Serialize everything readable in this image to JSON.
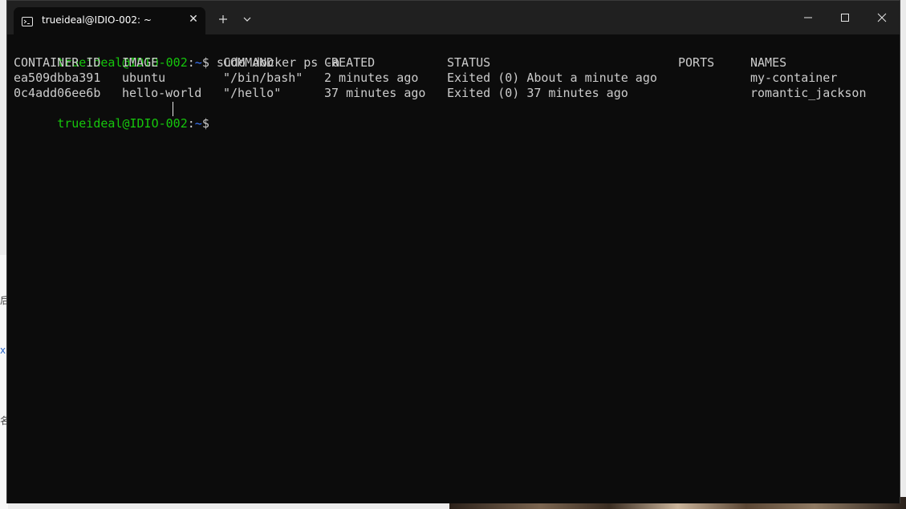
{
  "window": {
    "tab_title": "trueideal@IDIO-002: ~",
    "tab_icon": "terminal-icon",
    "close_tab_glyph": "✕",
    "new_tab_glyph": "+",
    "dropdown_glyph": "⌄"
  },
  "colors": {
    "user_host": "#16c60c",
    "path": "#3b78ff",
    "text": "#cccccc",
    "background": "#0c0c0c",
    "titlebar": "#202020"
  },
  "prompt": {
    "user_host": "trueideal@IDIO-002",
    "colon": ":",
    "path": "~",
    "symbol": "$ "
  },
  "command": "sudo docker ps -a",
  "table": {
    "headers": [
      "CONTAINER ID",
      "IMAGE",
      "COMMAND",
      "CREATED",
      "STATUS",
      "PORTS",
      "NAMES"
    ],
    "rows": [
      [
        "ea509dbba391",
        "ubuntu",
        "\"/bin/bash\"",
        "2 minutes ago",
        "Exited (0) About a minute ago",
        "",
        "my-container"
      ],
      [
        "0c4add06ee6b",
        "hello-world",
        "\"/hello\"",
        "37 minutes ago",
        "Exited (0) 37 minutes ago",
        "",
        "romantic_jackson"
      ]
    ]
  },
  "background_fragments": [
    "后",
    "x",
    "名"
  ]
}
